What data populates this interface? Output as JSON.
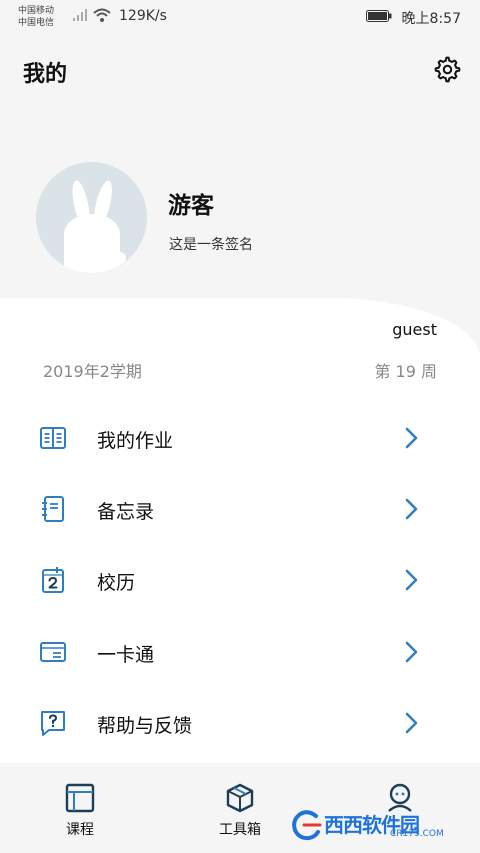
{
  "status_bar": {
    "carrier_1": "中国移动",
    "carrier_2": "中国电信",
    "network_speed": "129K/s",
    "time": "晚上8:57",
    "icons": [
      "signal-icon",
      "wifi-icon",
      "battery-icon"
    ]
  },
  "header": {
    "title": "我的",
    "settings_icon": "gear-icon"
  },
  "profile": {
    "name": "游客",
    "signature": "这是一条签名",
    "avatar_icon": "rabbit-avatar"
  },
  "account": {
    "username": "guest",
    "semester": "2019年2学期",
    "week": "第 19 周"
  },
  "menu": {
    "items": [
      {
        "label": "我的作业",
        "icon": "book-icon"
      },
      {
        "label": "备忘录",
        "icon": "notebook-icon"
      },
      {
        "label": "校历",
        "icon": "calendar-icon"
      },
      {
        "label": "一卡通",
        "icon": "card-icon"
      },
      {
        "label": "帮助与反馈",
        "icon": "help-icon"
      }
    ]
  },
  "bottom_nav": {
    "items": [
      {
        "label": "课程",
        "icon": "course-icon"
      },
      {
        "label": "工具箱",
        "icon": "toolbox-icon"
      }
    ],
    "profile_icon": "profile-icon"
  },
  "watermark": {
    "text": "西西软件园",
    "sub": "CR173.COM"
  },
  "colors": {
    "accent": "#2f7fc0",
    "icon_dark": "#1d3e57",
    "background": "#f5f5f5",
    "card": "#ffffff",
    "avatar_bg": "#d9e3e8"
  }
}
